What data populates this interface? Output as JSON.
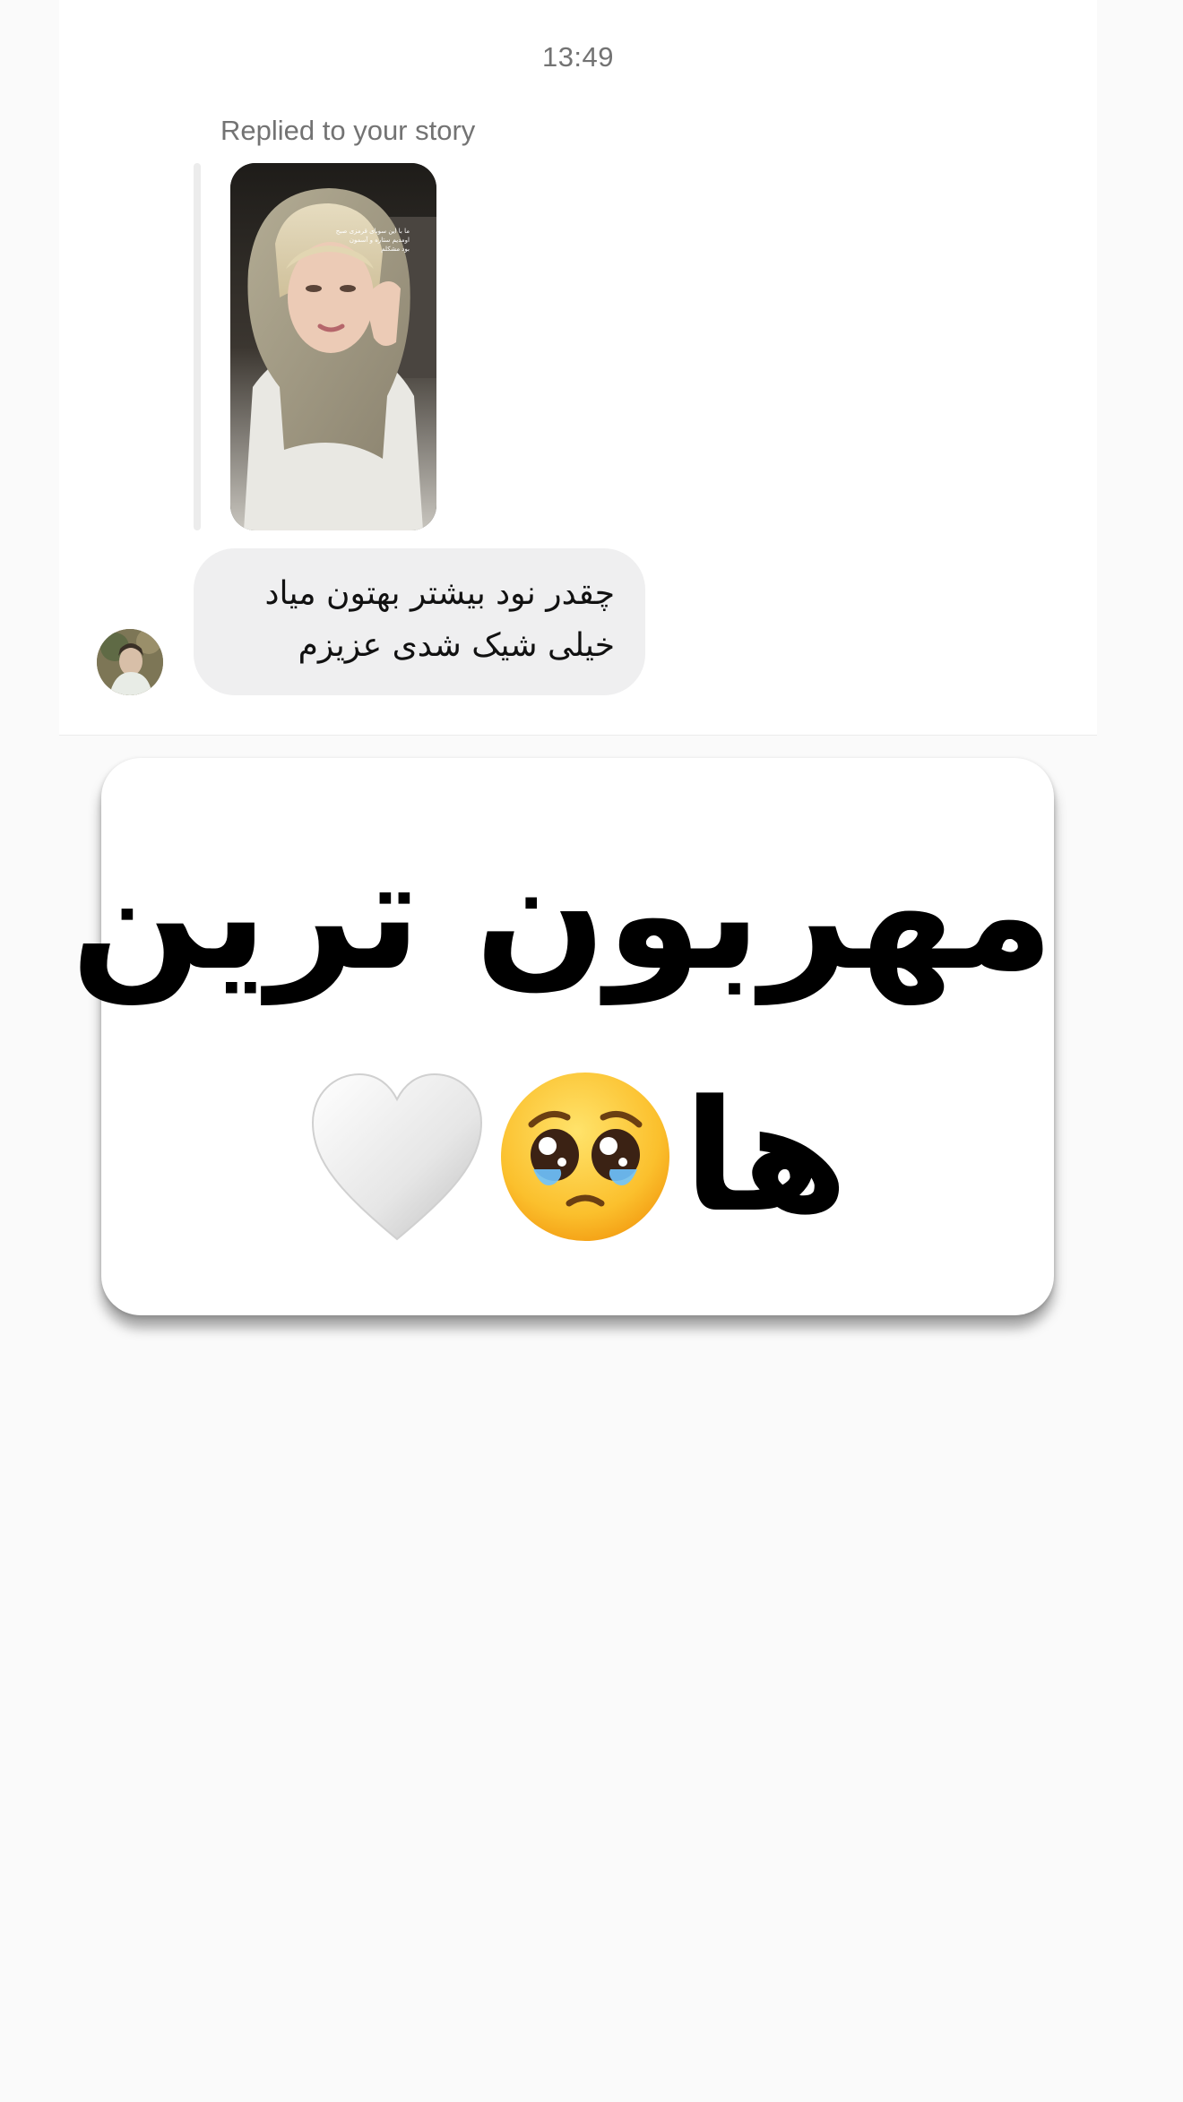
{
  "chat": {
    "timestamp": "13:49",
    "reply_label": "Replied to your story",
    "story_overlay_text": [
      "ما با این سوبای قرمزی صبح",
      "اومدیم ستاره و آسمون",
      "بود مشکلم"
    ],
    "message": {
      "lines": [
        "چقدر نود بیشتر بهتون میاد",
        "خیلی شیک شدی عزیزم"
      ]
    }
  },
  "sticker": {
    "line1": "مهربون ترین",
    "line2_word": "ها",
    "emoji_face": "pleading-face-icon",
    "emoji_heart": "white-heart-icon"
  },
  "colors": {
    "background": "#fafafa",
    "chat_panel": "#ffffff",
    "bubble": "#efeff0",
    "meta_text": "#737373"
  }
}
